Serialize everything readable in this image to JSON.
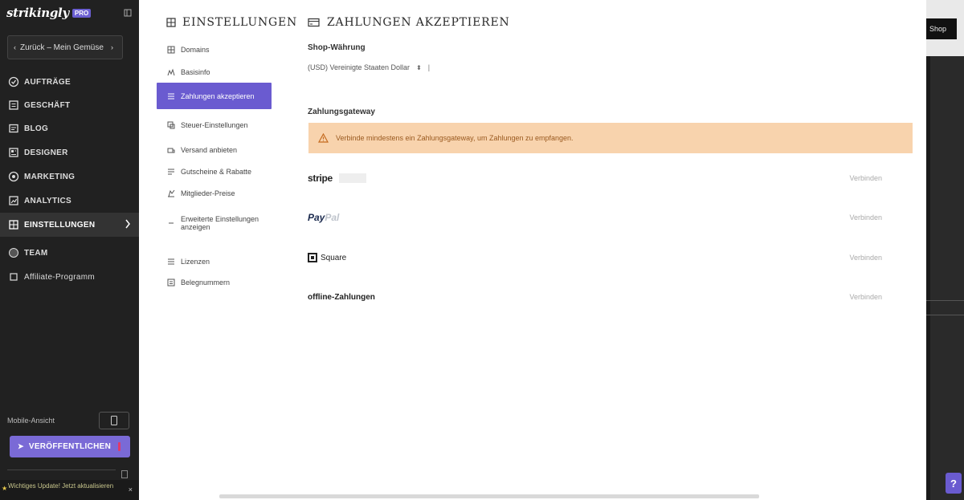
{
  "app": {
    "logo": "strikingly",
    "logo_badge": "PRO"
  },
  "sidebar": {
    "back_label": "Zurück – Mein Gemüse",
    "items": [
      {
        "label": "AUFTRÄGE",
        "icon": "orders-icon"
      },
      {
        "label": "GESCHÄFT",
        "icon": "store-icon"
      },
      {
        "label": "BLOG",
        "icon": "blog-icon"
      },
      {
        "label": "DESIGNER",
        "icon": "designer-icon"
      },
      {
        "label": "MARKETING",
        "icon": "marketing-icon"
      },
      {
        "label": "ANALYTICS",
        "icon": "analytics-icon"
      },
      {
        "label": "EINSTELLUNGEN",
        "icon": "settings-icon"
      },
      {
        "label": "TEAM",
        "icon": "team-icon"
      },
      {
        "label": "Affiliate-Programm",
        "icon": "affiliate-icon"
      }
    ],
    "mobile_label": "Mobile-Ansicht",
    "publish_label": "VERÖFFENTLICHEN",
    "notice": "Wichtiges Update! Jetzt aktualisieren"
  },
  "settings": {
    "title": "EINSTELLUNGEN",
    "items": [
      {
        "label": "Domains"
      },
      {
        "label": "Basisinfo"
      },
      {
        "label": "Zahlungen akzeptieren"
      },
      {
        "label": "Steuer-Einstellungen"
      },
      {
        "label": "Versand anbieten"
      },
      {
        "label": "Gutscheine & Rabatte"
      },
      {
        "label": "Mitglieder-Preise"
      },
      {
        "label": "Erweiterte Einstellungen anzeigen"
      },
      {
        "label": "Lizenzen"
      },
      {
        "label": "Belegnummern"
      }
    ]
  },
  "main": {
    "title": "ZAHLUNGEN AKZEPTIEREN",
    "currency_label": "Shop-Währung",
    "currency_value": "(USD) Vereinigte Staaten Dollar",
    "gateway_label": "Zahlungsgateway",
    "warning": "Verbinde mindestens ein Zahlungsgateway, um Zahlungen zu empfangen.",
    "gateways": [
      {
        "name": "stripe",
        "status": "Verbinden"
      },
      {
        "name": "PayPal",
        "status": "Verbinden"
      },
      {
        "name": "Square",
        "status": "Verbinden"
      },
      {
        "name": "offline-Zahlungen",
        "status": "Verbinden"
      }
    ]
  },
  "preview": {
    "button": "Shop",
    "help": "?"
  },
  "colors": {
    "accent": "#6a5bd0",
    "sidebar_bg": "#212121",
    "warning_bg": "#f8d3ad"
  }
}
